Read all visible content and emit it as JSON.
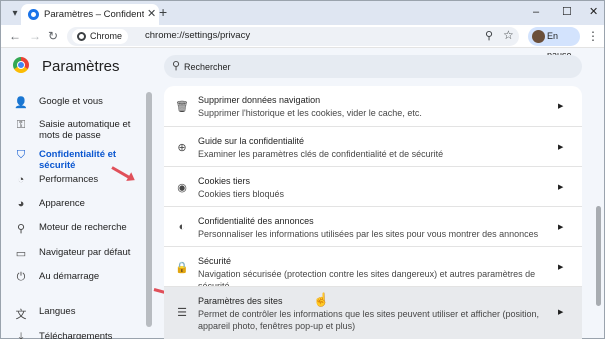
{
  "window": {
    "tab_title": "Paramètres – Confidentialité et",
    "new_tab_glyph": "+",
    "minimize_glyph": "–",
    "maximize_glyph": "☐",
    "close_glyph": "✕"
  },
  "toolbar": {
    "chip_label": "Chrome",
    "url": "chrome://settings/privacy",
    "profile_label": "En pause"
  },
  "header": {
    "title": "Paramètres",
    "search_placeholder": "Rechercher"
  },
  "sidebar": {
    "items": [
      {
        "label": "Google et vous",
        "icon": "person-icon"
      },
      {
        "label": "Saisie automatique et mots de passe",
        "icon": "key-icon"
      },
      {
        "label": "Confidentialité et sécurité",
        "icon": "shield-icon",
        "active": true
      },
      {
        "label": "Performances",
        "icon": "gauge-icon"
      },
      {
        "label": "Apparence",
        "icon": "palette-icon"
      },
      {
        "label": "Moteur de recherche",
        "icon": "search-icon"
      },
      {
        "label": "Navigateur par défaut",
        "icon": "browser-icon"
      },
      {
        "label": "Au démarrage",
        "icon": "power-icon"
      },
      {
        "label": "Langues",
        "icon": "translate-icon"
      },
      {
        "label": "Téléchargements",
        "icon": "download-icon"
      }
    ]
  },
  "privacy": {
    "rows": [
      {
        "title": "Supprimer données navigation",
        "subtitle": "Supprimer l'historique et les cookies, vider le cache, etc.",
        "icon": "trash-icon"
      },
      {
        "title": "Guide sur la confidentialité",
        "subtitle": "Examiner les paramètres clés de confidentialité et de sécurité",
        "icon": "plus-circle-icon"
      },
      {
        "title": "Cookies tiers",
        "subtitle": "Cookies tiers bloqués",
        "icon": "cookie-icon"
      },
      {
        "title": "Confidentialité des annonces",
        "subtitle": "Personnaliser les informations utilisées par les sites pour vous montrer des annonces",
        "icon": "ad-privacy-icon"
      },
      {
        "title": "Sécurité",
        "subtitle": "Navigation sécurisée (protection contre les sites dangereux) et autres paramètres de sécurité",
        "icon": "lock-icon"
      },
      {
        "title": "Paramètres des sites",
        "subtitle": "Permet de contrôler les informations que les sites peuvent utiliser et afficher (position, appareil photo, fenêtres pop-up et plus)",
        "icon": "sliders-icon"
      }
    ]
  },
  "colors": {
    "accent": "#0b57d0",
    "annotation_arrow": "#e0505a"
  }
}
